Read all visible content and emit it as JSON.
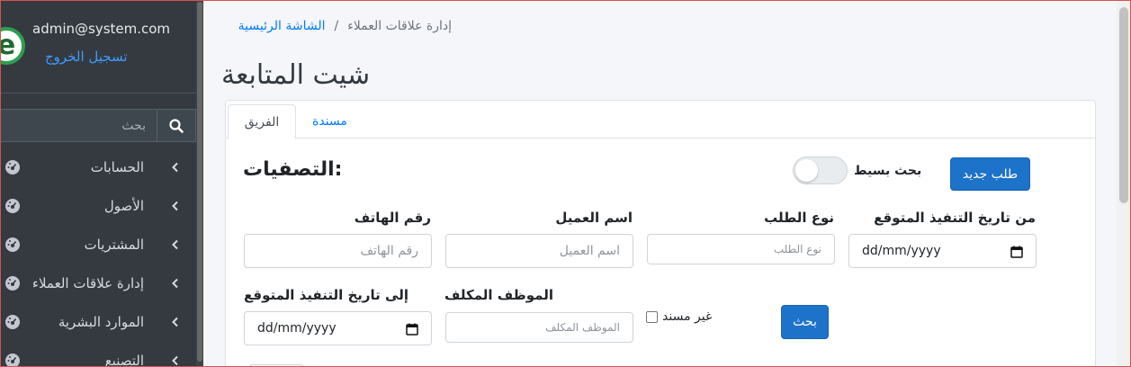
{
  "user": {
    "email": "admin@system.com",
    "logout": "تسجيل الخروج"
  },
  "sidebar": {
    "search_placeholder": "بحث",
    "items": [
      {
        "label": "الحسابات"
      },
      {
        "label": "الأصول"
      },
      {
        "label": "المشتريات"
      },
      {
        "label": "إدارة علاقات العملاء"
      },
      {
        "label": "الموارد البشرية"
      },
      {
        "label": "التصنيع"
      }
    ]
  },
  "breadcrumb": {
    "home": "الشاشة الرئيسية",
    "separator": "/",
    "current": "إدارة علاقات العملاء"
  },
  "page": {
    "title": "شيت المتابعة"
  },
  "tabs": {
    "team": "الفريق",
    "assigned": "مسندة"
  },
  "filters": {
    "title": ":التصفيات",
    "simple_search": "بحث بسيط",
    "new_request": "طلب جديد",
    "from_date_label": "من تاريخ التنفيذ المتوقع",
    "from_date_value": "dd/mm/yyyy",
    "request_type_label": "نوع الطلب",
    "request_type_placeholder": "نوع الطلب",
    "customer_name_label": "اسم العميل",
    "customer_name_placeholder": "اسم العميل",
    "phone_label": "رقم الهاتف",
    "phone_placeholder": "رقم الهاتف",
    "unassigned_label": "غير مسند",
    "employee_label": "الموظف المكلف",
    "employee_placeholder": "الموظف المكلف",
    "to_date_label": "إلى تاريخ التنفيذ المتوقع",
    "to_date_value": "dd/mm/yyyy",
    "search_button": "بحث"
  },
  "colors": {
    "primary": "#1d72c9",
    "sidebar": "#343a40",
    "link": "#007bff"
  }
}
